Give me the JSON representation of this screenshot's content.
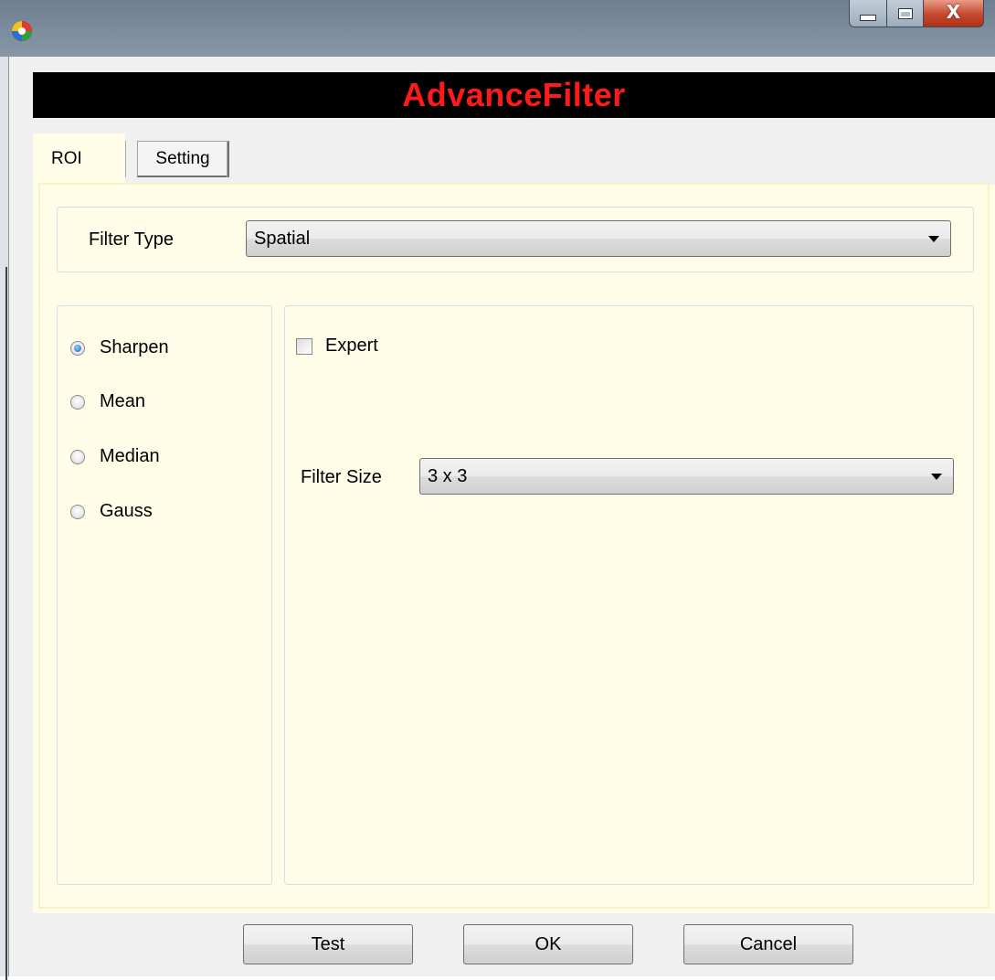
{
  "window": {
    "app_icon": "app-logo-icon",
    "controls": {
      "minimize_icon": "minimize-icon",
      "maximize_icon": "maximize-icon",
      "close_icon": "close-icon",
      "close_glyph": "X"
    }
  },
  "banner": {
    "title": "AdvanceFilter",
    "title_color": "#ff1a1a",
    "background": "#000000"
  },
  "tabs": [
    {
      "label": "ROI",
      "selected": false
    },
    {
      "label": "Setting",
      "selected": true
    }
  ],
  "filter_type": {
    "label": "Filter Type",
    "value": "Spatial"
  },
  "methods": {
    "options": [
      {
        "label": "Sharpen",
        "checked": true
      },
      {
        "label": "Mean",
        "checked": false
      },
      {
        "label": "Median",
        "checked": false
      },
      {
        "label": "Gauss",
        "checked": false
      }
    ]
  },
  "expert": {
    "label": "Expert",
    "checked": false
  },
  "filter_size": {
    "label": "Filter Size",
    "value": "3 x 3"
  },
  "buttons": {
    "test": "Test",
    "ok": "OK",
    "cancel": "Cancel"
  },
  "colors": {
    "panel_background": "#fffde8"
  }
}
